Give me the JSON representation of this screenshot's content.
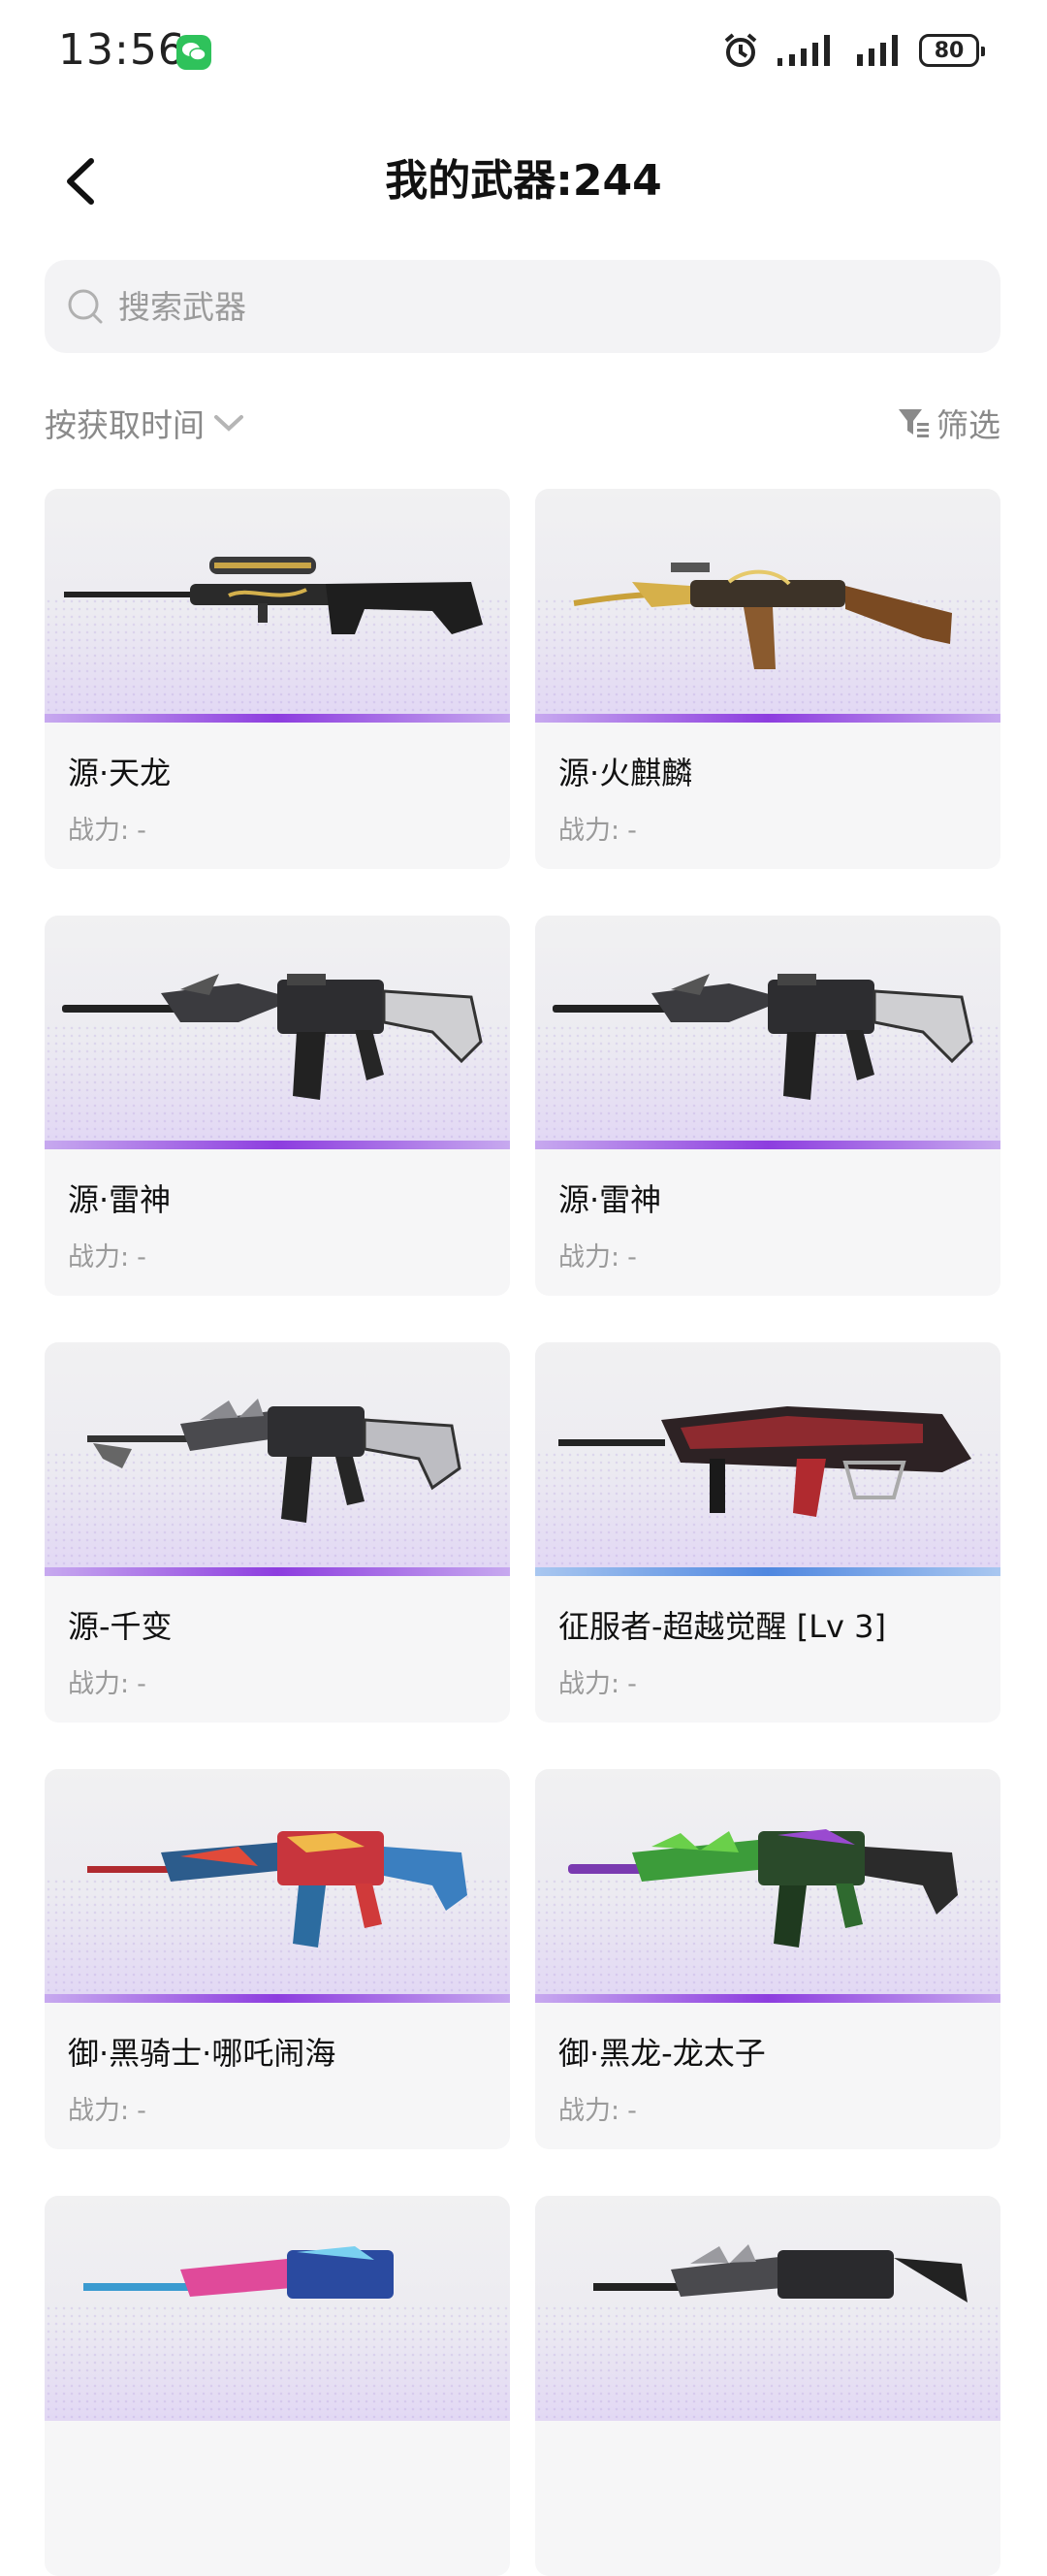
{
  "status_bar": {
    "time": "13:56",
    "battery": "80"
  },
  "header": {
    "title": "我的武器:244"
  },
  "search": {
    "placeholder": "搜索武器"
  },
  "toolbar": {
    "sort_label": "按获取时间",
    "filter_label": "筛选"
  },
  "weapons": [
    {
      "name": "源·天龙",
      "power_label": "战力:",
      "power_value": "-",
      "rarity": "purple",
      "image": "sniper-rifle"
    },
    {
      "name": "源·火麒麟",
      "power_label": "战力:",
      "power_value": "-",
      "rarity": "purple",
      "image": "assault-rifle-gold"
    },
    {
      "name": "源·雷神",
      "power_label": "战力:",
      "power_value": "-",
      "rarity": "purple",
      "image": "rifle-dark"
    },
    {
      "name": "源·雷神",
      "power_label": "战力:",
      "power_value": "-",
      "rarity": "purple",
      "image": "rifle-dark"
    },
    {
      "name": "源-千变",
      "power_label": "战力:",
      "power_value": "-",
      "rarity": "purple",
      "image": "rifle-bladed"
    },
    {
      "name": "征服者-超越觉醒 [Lv 3]",
      "power_label": "战力:",
      "power_value": "-",
      "rarity": "blue",
      "image": "rifle-red"
    },
    {
      "name": "御·黑骑士·哪吒闹海",
      "power_label": "战力:",
      "power_value": "-",
      "rarity": "purple",
      "image": "rifle-colorful"
    },
    {
      "name": "御·黑龙-龙太子",
      "power_label": "战力:",
      "power_value": "-",
      "rarity": "purple",
      "image": "rifle-green"
    },
    {
      "name": "",
      "power_label": "",
      "power_value": "",
      "rarity": "none",
      "image": "rifle-blue-pink"
    },
    {
      "name": "",
      "power_label": "",
      "power_value": "",
      "rarity": "none",
      "image": "rifle-dark-dragon"
    }
  ],
  "colors": {
    "rarity_purple": "#8d3ddf",
    "rarity_blue": "#4f87e0",
    "wechat_green": "#2fc25b"
  }
}
